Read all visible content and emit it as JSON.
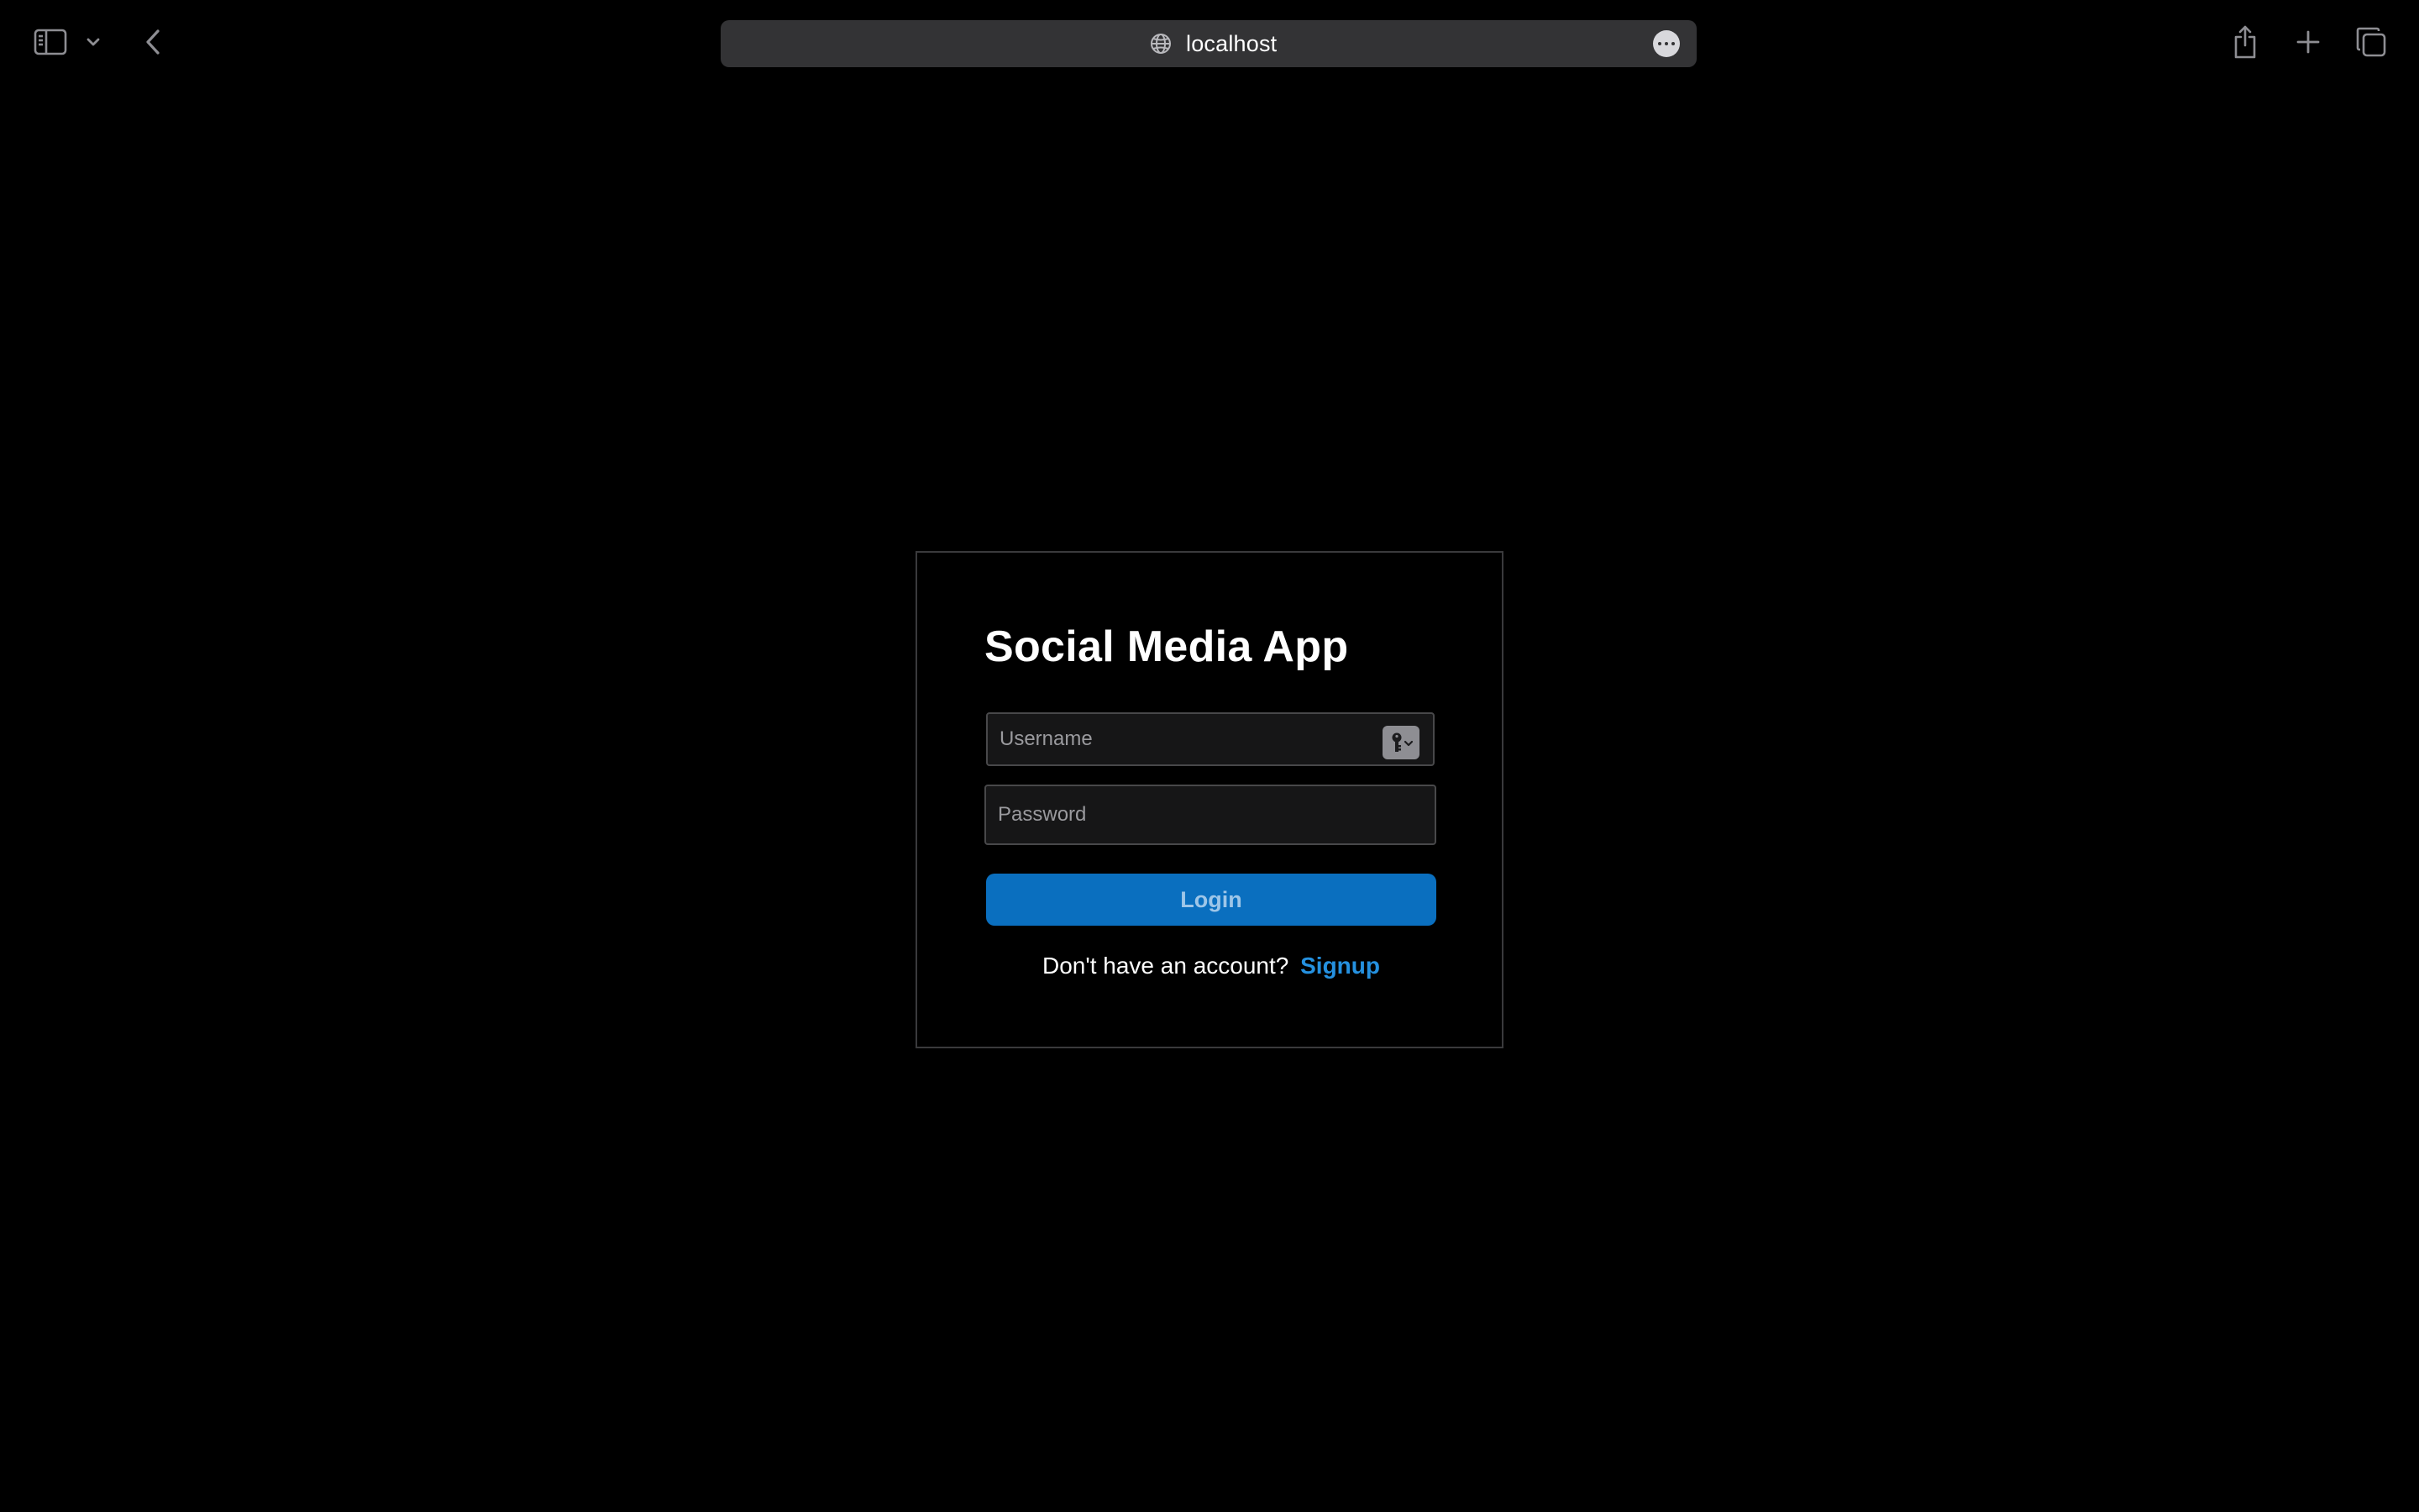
{
  "browser": {
    "url": "localhost"
  },
  "icons": {
    "sidebar": "sidebar-icon",
    "tabs_chevron": "chevron-down-icon",
    "back": "chevron-left-icon",
    "site": "globe-icon",
    "more": "ellipsis-circle-icon",
    "share": "share-icon",
    "new_tab": "plus-icon",
    "tab_overview": "tab-overview-icon",
    "password_key": "key-icon"
  },
  "login": {
    "title": "Social Media App",
    "username_placeholder": "Username",
    "password_placeholder": "Password",
    "login_label": "Login",
    "signup_prompt": "Don't have an account?",
    "signup_label": "Signup"
  },
  "colors": {
    "background": "#000000",
    "address_bar": "#333335",
    "accent_button": "#0a6fbf",
    "link": "#2591e0"
  }
}
